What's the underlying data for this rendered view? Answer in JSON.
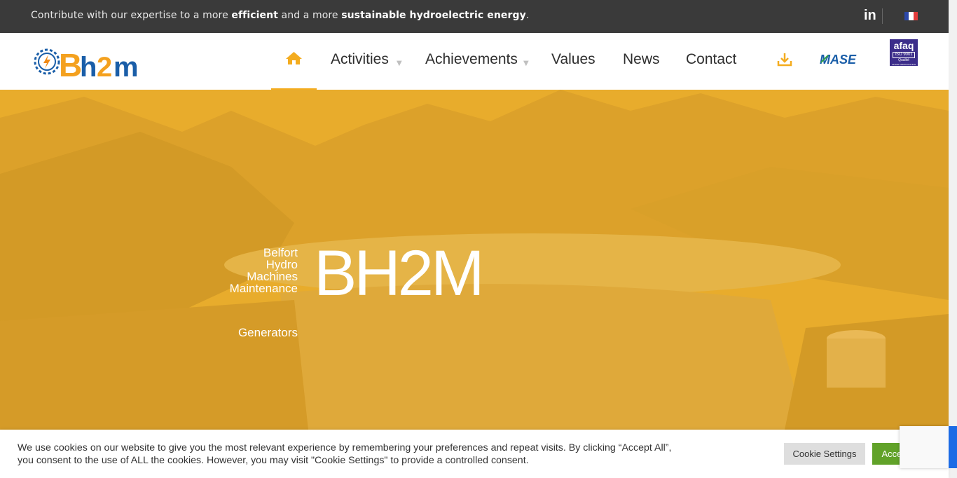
{
  "topbar": {
    "tagline_pre": "Contribute with our expertise to a more ",
    "tagline_b1": "efficient",
    "tagline_mid": " and a more ",
    "tagline_b2": "sustainable hydroelectric energy",
    "tagline_end": ".",
    "linkedin_label": "in"
  },
  "nav": {
    "home_icon": "home-icon",
    "items": [
      "Activities",
      "Achievements",
      "Values",
      "News",
      "Contact"
    ],
    "submenu_indicator": "+"
  },
  "certifications": {
    "mase_label": "MASE",
    "afaq_line1": "afaq",
    "afaq_line2": "ISO 9001",
    "afaq_line3": "Qualité",
    "afaq_line4": "AFNOR CERTIFICATION"
  },
  "logo": {
    "text": "Bh2m"
  },
  "hero": {
    "subtitle_lines": [
      "Belfort",
      "Hydro",
      "Machines",
      "Maintenance"
    ],
    "title": "BH2M",
    "tag": "Generators"
  },
  "cookie": {
    "text": "We use cookies on our website to give you the most relevant experience by remembering your preferences and repeat visits. By clicking “Accept All”, you consent to the use of ALL the cookies. However, you may visit \"Cookie Settings\" to provide a controlled consent.",
    "settings_label": "Cookie Settings",
    "accept_label": "Accept All"
  },
  "colors": {
    "accent": "#f4ac1f",
    "hero_overlay": "#e8ac2c",
    "topbar_bg": "#3a3a3a",
    "accept_green": "#61a229",
    "logo_blue": "#1a5ea8"
  }
}
